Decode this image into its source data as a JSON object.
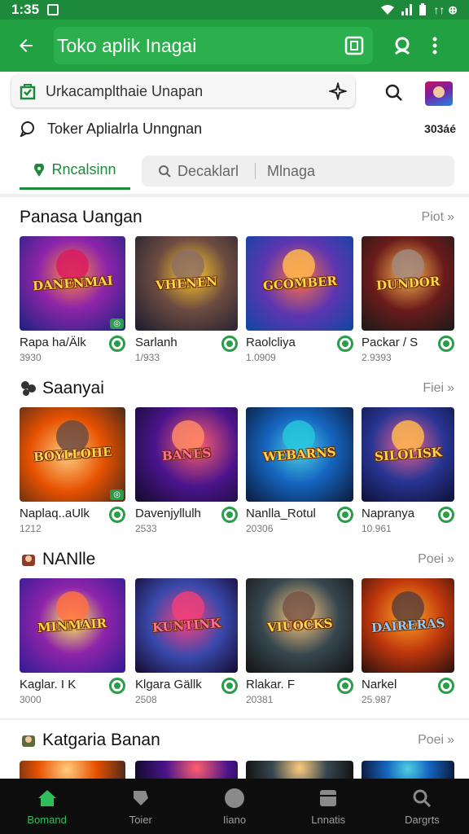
{
  "status_bar": {
    "time": "1:35",
    "right_text": "↑↑ ⊕"
  },
  "app_bar": {
    "title": "Toko aplik Inagai"
  },
  "search": {
    "text": "Urkacamplthaie Unapan"
  },
  "suggestion": {
    "text": "Toker Aplialrla Unngnan",
    "count": "303áé"
  },
  "tabs": {
    "active": "Rncalsinn",
    "second": "Decaklarl",
    "third": "Mlnaga"
  },
  "sections": [
    {
      "title": "Panasa Uangan",
      "more": "Piot",
      "cards": [
        {
          "name": "Rapa ha/Älk",
          "meta": "3930",
          "logo": "DANENMAI"
        },
        {
          "name": "Sarlanh",
          "meta": "1/933",
          "logo": "VHENEN"
        },
        {
          "name": "Raolcliya",
          "meta": "1.0909",
          "logo": "GCOMBER"
        },
        {
          "name": "Packar / S",
          "meta": "2.9393",
          "logo": "DUNDOR"
        }
      ]
    },
    {
      "title": "Saanyai",
      "more": "Fiei",
      "cards": [
        {
          "name": "Naplaq..aUlk",
          "meta": "1212",
          "logo": "BOYLLOHE"
        },
        {
          "name": "Davenjyllulh",
          "meta": "2533",
          "logo": "BANES"
        },
        {
          "name": "Nanlla_Rotul",
          "meta": "20306",
          "logo": "WEBARNS"
        },
        {
          "name": "Napranya",
          "meta": "10.961",
          "logo": "SILOLISK"
        }
      ]
    },
    {
      "title": "NANlle",
      "more": "Poei",
      "cards": [
        {
          "name": "Kaglar. I K",
          "meta": "3000",
          "logo": "MINMAIR"
        },
        {
          "name": "Klgara Gällk",
          "meta": "2508",
          "logo": "KUNTINK"
        },
        {
          "name": "Rlakar. F",
          "meta": "20381",
          "logo": "VIUOCKS"
        },
        {
          "name": "Narkel",
          "meta": "25.987",
          "logo": "DAIRERAS"
        }
      ]
    },
    {
      "title": "Katgaria Banan",
      "more": "Poei"
    }
  ],
  "bottom_nav": [
    {
      "label": "Bomand",
      "icon": "home-icon"
    },
    {
      "label": "Toier",
      "icon": "game-icon"
    },
    {
      "label": "Iiano",
      "icon": "circle-icon"
    },
    {
      "label": "Lnnatis",
      "icon": "apps-icon"
    },
    {
      "label": "Dargrts",
      "icon": "search-icon"
    }
  ],
  "colors": {
    "primary": "#21a142",
    "status": "#1c8a3a",
    "accent": "#2fbf5a",
    "nav_bg": "#0d0d0d"
  }
}
